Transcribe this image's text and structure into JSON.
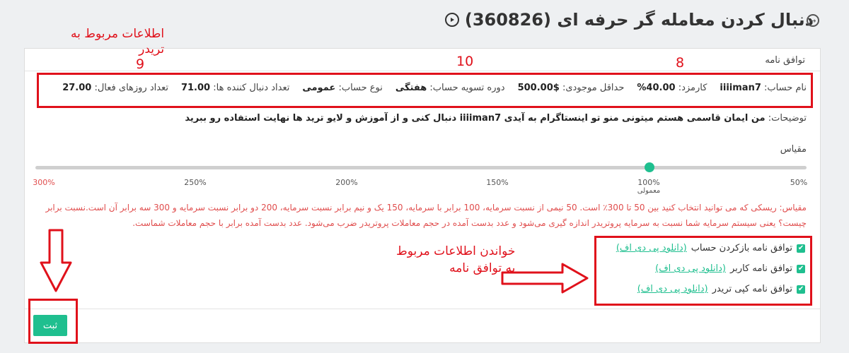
{
  "page": {
    "title": "دنبال کردن معامله گر حرفه ای (360826)"
  },
  "agreement_section": {
    "label": "توافق نامه"
  },
  "trader_info": {
    "account_name_label": "نام حساب:",
    "account_name": "iiiiman7",
    "fee_label": "کارمزد:",
    "fee": "40.00%",
    "min_balance_label": "حداقل موجودی:",
    "min_balance": "$500.00",
    "settlement_label": "دوره تسویه حساب:",
    "settlement": "هفتگی",
    "account_type_label": "نوع حساب:",
    "account_type": "عمومی",
    "followers_label": "تعداد دنبال کننده ها:",
    "followers": "71.00",
    "active_days_label": "تعداد روزهای فعال:",
    "active_days": "27.00"
  },
  "description": {
    "label": "توضیحات:",
    "text": "من ایمان قاسمی هستم میتونی منو تو اینستاگرام به آیدی iiiiman7 دنبال کنی و از آموزش و لایو ترید ها نهایت استفاده رو ببرید"
  },
  "scale": {
    "label": "مقیاس",
    "value_percent": 100,
    "min_percent": 50,
    "max_percent": 300,
    "ticks": [
      "50%",
      "100%",
      "150%",
      "200%",
      "250%",
      "300%"
    ],
    "normal_label": "معمولی"
  },
  "scale_note": {
    "text": "مقیاس: ریسکی که می توانید انتخاب کنید بین 50 تا 300٪ است. 50 نیمی از نسبت سرمایه، 100 برابر با سرمایه، 150 یک و نیم برابر نسبت سرمایه، 200 دو برابر نسبت سرمایه و 300 سه برابر آن است.نسبت برابر چیست؟ یعنی سیستم سرمایه شما نسبت به سرمایه پروتریدر اندازه گیری می‌شود و عدد بدست آمده در حجم معاملات پروتریدر ضرب می‌شود. عدد بدست آمده برابر با حجم معاملات شماست."
  },
  "agreements": [
    {
      "label": "توافق نامه بازکردن حساب",
      "link": "(دانلود پی دی اف)",
      "checked": true
    },
    {
      "label": "توافق نامه کاربر",
      "link": "(دانلود پی دی اف)",
      "checked": true
    },
    {
      "label": "توافق نامه کپی تریدر",
      "link": "(دانلود پی دی اف)",
      "checked": true
    }
  ],
  "submit": {
    "label": "ثبت"
  },
  "annotations": {
    "trader_info_note_line1": "اطلاعات مربوط به",
    "trader_info_note_line2": "تریدر",
    "num_9": "9",
    "num_10": "10",
    "num_8": "8",
    "agreements_note_line1": "خواندن اطلاعات مربوط",
    "agreements_note_line2": "به توافق نامه"
  },
  "colors": {
    "accent": "#1fbf8f",
    "annotation_red": "#e0111b",
    "note_red": "#e04d4d"
  }
}
